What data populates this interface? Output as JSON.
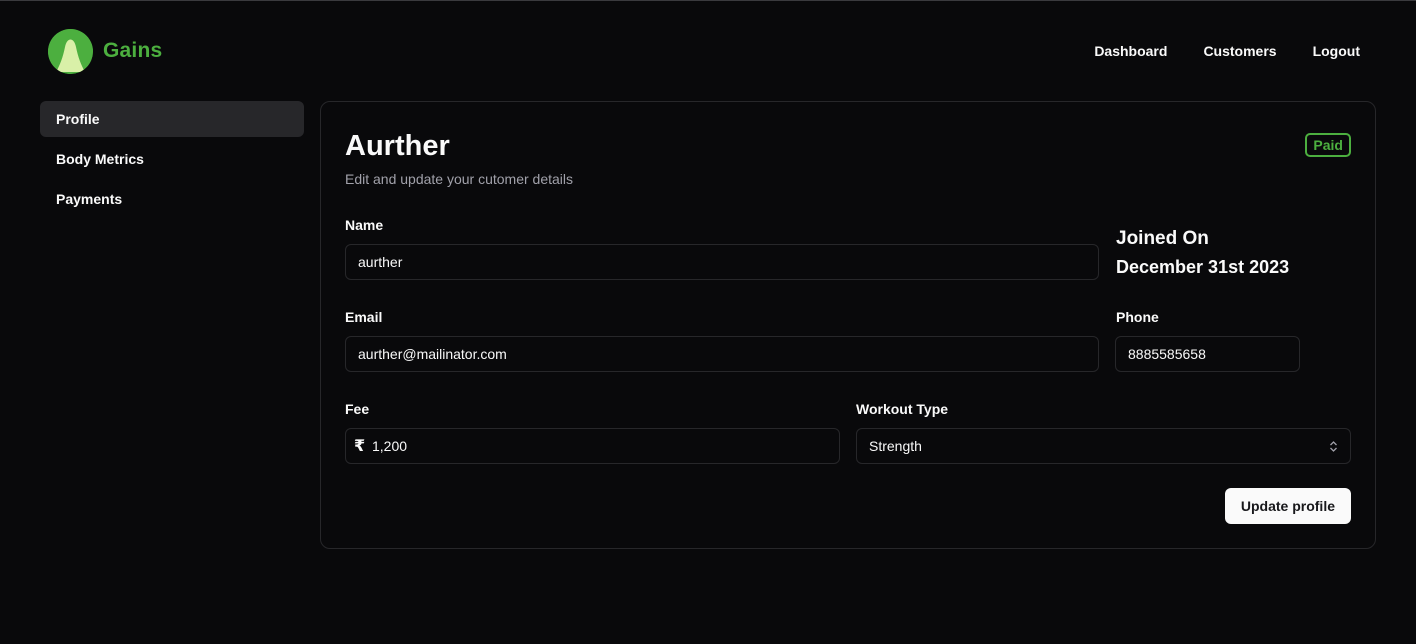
{
  "app": {
    "brand": "Gains"
  },
  "nav": {
    "dashboard": "Dashboard",
    "customers": "Customers",
    "logout": "Logout"
  },
  "sidebar": {
    "items": [
      {
        "label": "Profile",
        "active": true
      },
      {
        "label": "Body Metrics",
        "active": false
      },
      {
        "label": "Payments",
        "active": false
      }
    ]
  },
  "profile": {
    "name": "Aurther",
    "subtitle": "Edit and update your cutomer details",
    "status_badge": "Paid",
    "joined_label": "Joined On",
    "joined_date": "December 31st 2023",
    "fields": {
      "name_label": "Name",
      "name_value": "aurther",
      "email_label": "Email",
      "email_value": "aurther@mailinator.com",
      "phone_label": "Phone",
      "phone_value": "8885585658",
      "fee_label": "Fee",
      "fee_currency": "₹",
      "fee_value": "1,200",
      "workout_label": "Workout Type",
      "workout_value": "Strength"
    },
    "update_button": "Update profile"
  },
  "colors": {
    "accent": "#4caf3f",
    "background": "#09090b",
    "border": "#27272a",
    "muted": "#a1a1aa"
  },
  "icons": {
    "logo": "gains-logo-icon",
    "select": "chevron-up-down-icon",
    "currency": "rupee-icon"
  }
}
